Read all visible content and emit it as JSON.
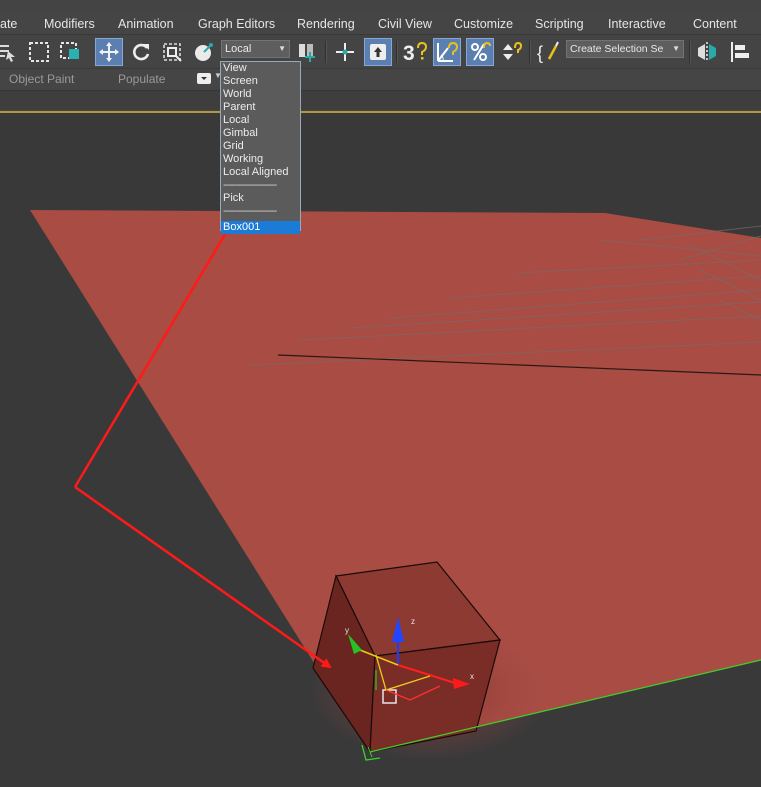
{
  "menu": {
    "items": [
      "ate",
      "Modifiers",
      "Animation",
      "Graph Editors",
      "Rendering",
      "Civil View",
      "Customize",
      "Scripting",
      "Interactive",
      "Content"
    ]
  },
  "toolbar": {
    "reference_coord_value": "Local",
    "selection_set_placeholder": "Create Selection Se",
    "snap_label": "3"
  },
  "ribbon": {
    "tabs": [
      "Object Paint",
      "Populate"
    ]
  },
  "ref_coord_dropdown": {
    "options": [
      "View",
      "Screen",
      "World",
      "Parent",
      "Local",
      "Gimbal",
      "Grid",
      "Working",
      "Local Aligned"
    ],
    "separator": "--------------------",
    "pick_label": "Pick",
    "selected_object": "Box001"
  },
  "viewport": {
    "gizmo_axes": {
      "x": "x",
      "y": "y",
      "z": "z"
    },
    "colors": {
      "plane": "#a84c44",
      "box": "#7c2a24",
      "annotation_arrow": "#ff1a1a",
      "viewport_border": "#b4963c"
    }
  }
}
